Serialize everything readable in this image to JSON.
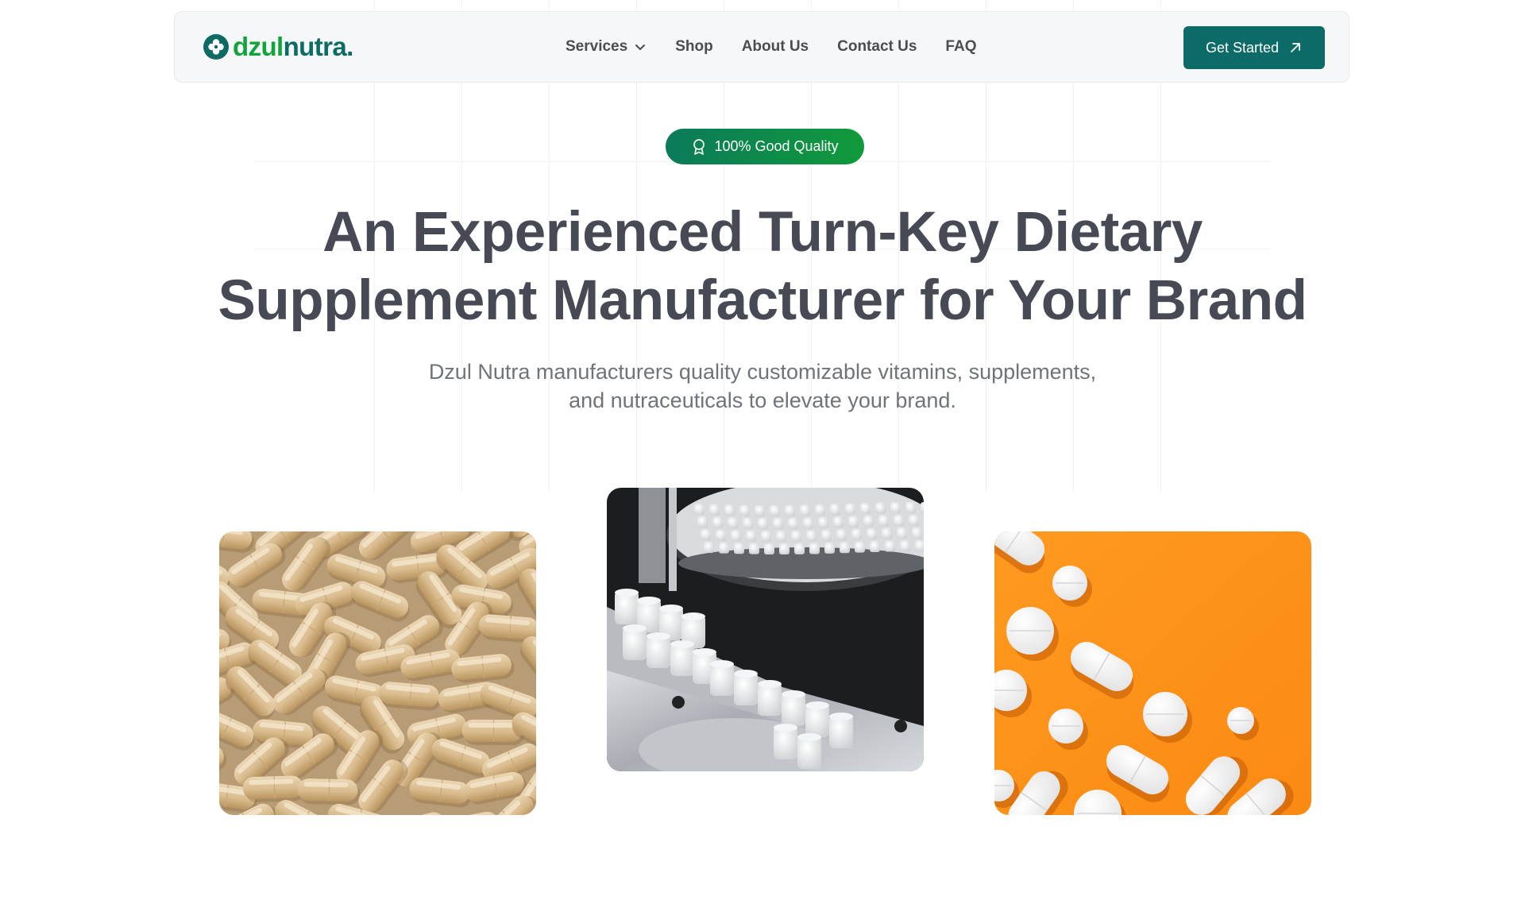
{
  "brand": {
    "name_part1": "dzul",
    "name_part2": "nutra",
    "name_dot": ".",
    "primary_color": "#0c6b66",
    "accent_color": "#12a33a"
  },
  "nav": {
    "items": [
      {
        "label": "Services",
        "icon": "chevron-down-icon"
      },
      {
        "label": "Shop"
      },
      {
        "label": "About Us"
      },
      {
        "label": "Contact Us"
      },
      {
        "label": "FAQ"
      }
    ],
    "cta_label": "Get Started",
    "cta_icon": "arrow-up-right-icon"
  },
  "hero": {
    "badge_text": "100% Good Quality",
    "badge_icon": "award-icon",
    "headline_line1": "An Experienced Turn-Key Dietary",
    "headline_line2": "Supplement Manufacturer for Your Brand",
    "subtitle_line1": "Dzul Nutra manufacturers quality customizable vitamins, supplements,",
    "subtitle_line2": "and nutraceuticals to elevate your brand."
  },
  "images": [
    {
      "subject": "beige-capsules-photo"
    },
    {
      "subject": "bottle-production-line-photo"
    },
    {
      "subject": "white-pills-on-orange-photo"
    }
  ]
}
